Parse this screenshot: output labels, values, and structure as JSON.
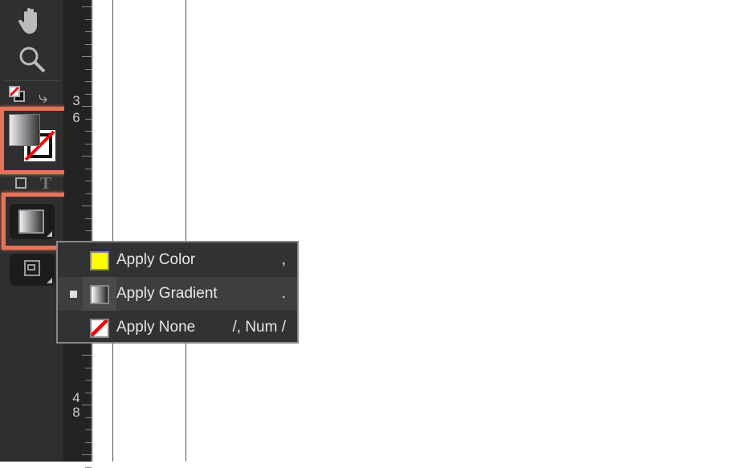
{
  "toolbar": {
    "tools": [
      {
        "name": "hand-tool",
        "icon": "hand-icon"
      },
      {
        "name": "zoom-tool",
        "icon": "magnifier-icon"
      }
    ],
    "fill_swatch": "gradient",
    "stroke_swatch": "none",
    "apply_button_state": "gradient"
  },
  "ruler": {
    "labels": [
      "3",
      "6",
      "4",
      "8"
    ]
  },
  "menu": {
    "items": [
      {
        "label": "Apply Color",
        "shortcut": ",",
        "swatch": "#ffff00",
        "selected": false
      },
      {
        "label": "Apply Gradient",
        "shortcut": ".",
        "swatch": "gradient",
        "selected": true
      },
      {
        "label": "Apply None",
        "shortcut": "/, Num /",
        "swatch": "none",
        "selected": false
      }
    ]
  },
  "colors": {
    "highlight": "#e8735a",
    "menu_bg": "#323232",
    "toolbar_bg": "#2f2f2f"
  }
}
